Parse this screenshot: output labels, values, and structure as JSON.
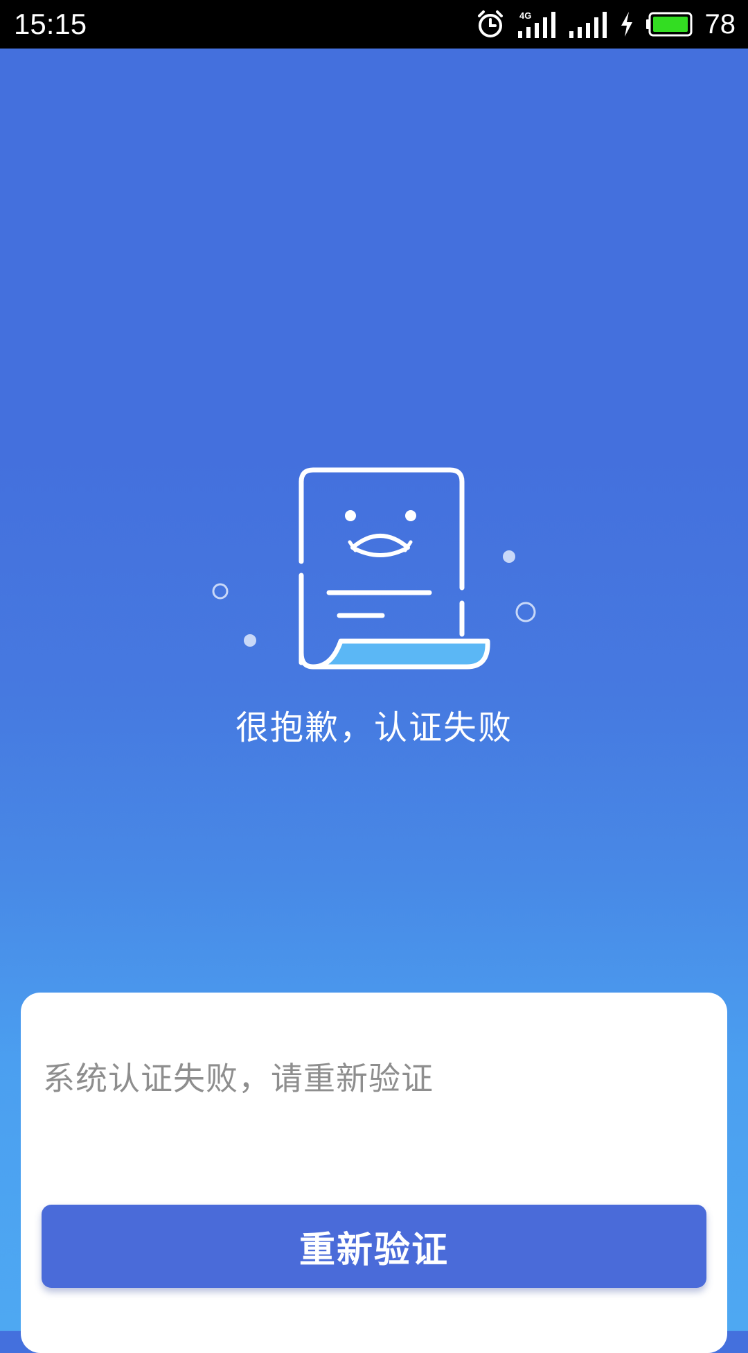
{
  "status_bar": {
    "time": "15:15",
    "network_label": "4G",
    "battery_level": "78",
    "icons": [
      "alarm-icon",
      "signal-4g-icon",
      "signal-icon",
      "charging-icon",
      "battery-icon"
    ]
  },
  "hero": {
    "illustration": "failed-document-icon",
    "title": "很抱歉，认证失败"
  },
  "card": {
    "message": "系统认证失败，请重新验证",
    "retry_button_label": "重新验证"
  },
  "colors": {
    "background_top": "#4470dd",
    "background_bottom": "#4ea8f2",
    "button": "#4a6bd9",
    "accent_light_blue": "#5bb7f5",
    "message_text": "#8e8e8e"
  }
}
